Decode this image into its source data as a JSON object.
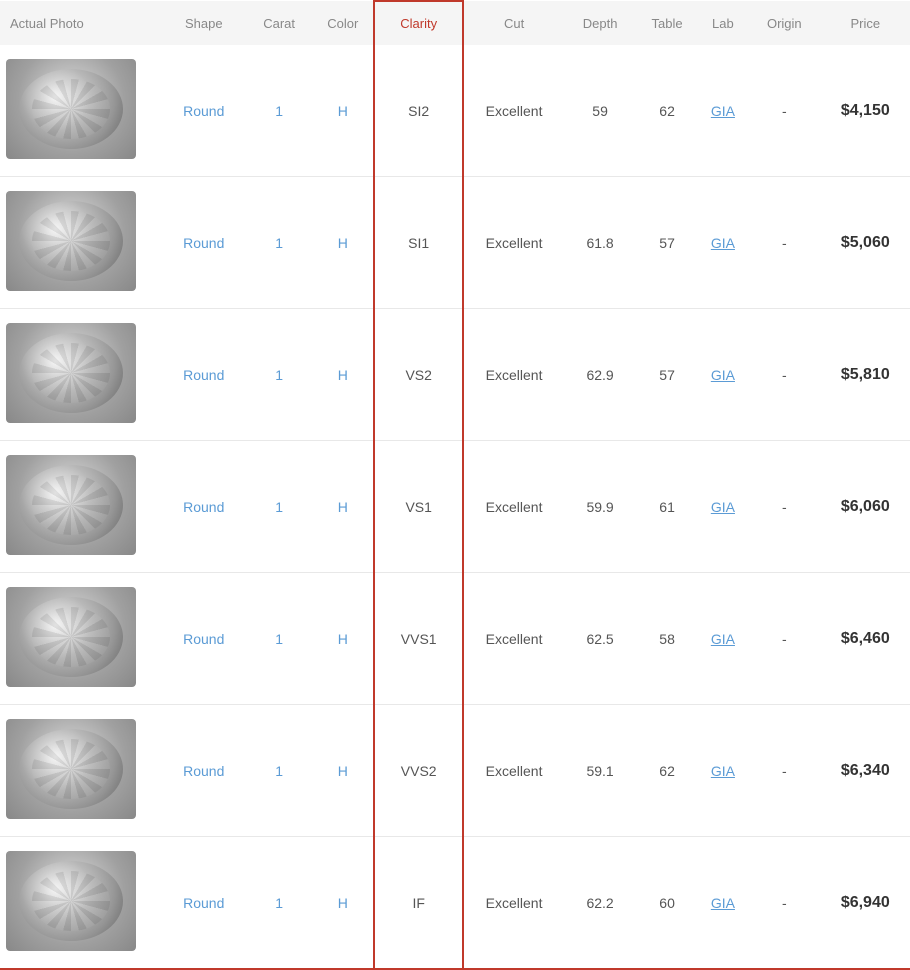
{
  "header": {
    "columns": [
      {
        "key": "photo",
        "label": "Actual Photo"
      },
      {
        "key": "shape",
        "label": "Shape"
      },
      {
        "key": "carat",
        "label": "Carat"
      },
      {
        "key": "color",
        "label": "Color"
      },
      {
        "key": "clarity",
        "label": "Clarity"
      },
      {
        "key": "cut",
        "label": "Cut"
      },
      {
        "key": "depth",
        "label": "Depth"
      },
      {
        "key": "table",
        "label": "Table"
      },
      {
        "key": "lab",
        "label": "Lab"
      },
      {
        "key": "origin",
        "label": "Origin"
      },
      {
        "key": "price",
        "label": "Price"
      }
    ]
  },
  "rows": [
    {
      "shape": "Round",
      "carat": "1",
      "color": "H",
      "clarity": "SI2",
      "cut": "Excellent",
      "depth": "59",
      "table": "62",
      "lab": "GIA",
      "origin": "-",
      "price": "$4,150"
    },
    {
      "shape": "Round",
      "carat": "1",
      "color": "H",
      "clarity": "SI1",
      "cut": "Excellent",
      "depth": "61.8",
      "table": "57",
      "lab": "GIA",
      "origin": "-",
      "price": "$5,060"
    },
    {
      "shape": "Round",
      "carat": "1",
      "color": "H",
      "clarity": "VS2",
      "cut": "Excellent",
      "depth": "62.9",
      "table": "57",
      "lab": "GIA",
      "origin": "-",
      "price": "$5,810"
    },
    {
      "shape": "Round",
      "carat": "1",
      "color": "H",
      "clarity": "VS1",
      "cut": "Excellent",
      "depth": "59.9",
      "table": "61",
      "lab": "GIA",
      "origin": "-",
      "price": "$6,060"
    },
    {
      "shape": "Round",
      "carat": "1",
      "color": "H",
      "clarity": "VVS1",
      "cut": "Excellent",
      "depth": "62.5",
      "table": "58",
      "lab": "GIA",
      "origin": "-",
      "price": "$6,460"
    },
    {
      "shape": "Round",
      "carat": "1",
      "color": "H",
      "clarity": "VVS2",
      "cut": "Excellent",
      "depth": "59.1",
      "table": "62",
      "lab": "GIA",
      "origin": "-",
      "price": "$6,340"
    },
    {
      "shape": "Round",
      "carat": "1",
      "color": "H",
      "clarity": "IF",
      "cut": "Excellent",
      "depth": "62.2",
      "table": "60",
      "lab": "GIA",
      "origin": "-",
      "price": "$6,940"
    }
  ]
}
